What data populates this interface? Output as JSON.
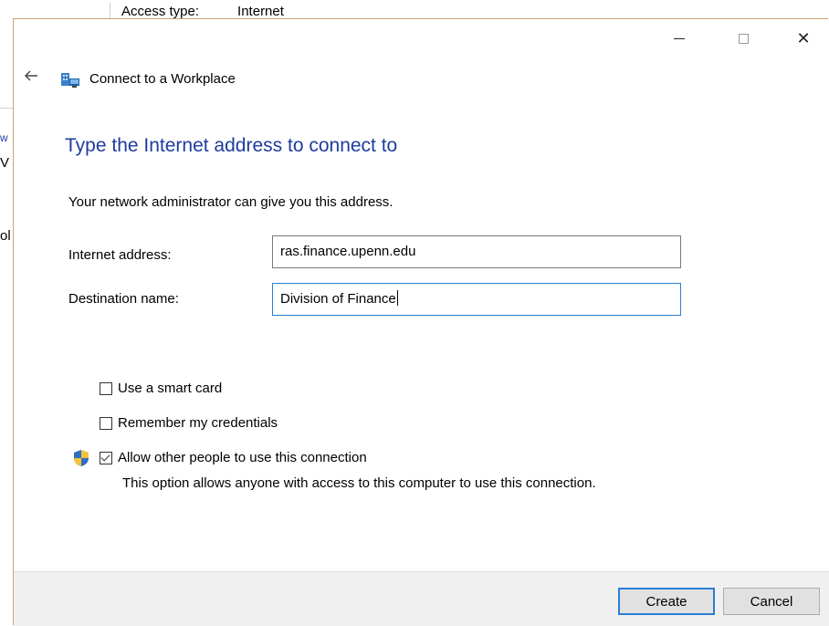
{
  "background": {
    "access_type_label": "Access type:",
    "access_type_value": "Internet",
    "left_fragments": [
      "w",
      "V",
      "ol"
    ]
  },
  "window": {
    "title": "Connect to a Workplace",
    "controls": {
      "minimize": "minimize",
      "maximize": "maximize",
      "close": "✕"
    }
  },
  "page": {
    "heading": "Type the Internet address to connect to",
    "instruction": "Your network administrator can give you this address.",
    "internet_address_label": "Internet address:",
    "internet_address_value": "ras.finance.upenn.edu",
    "destination_name_label": "Destination name:",
    "destination_name_value": "Division of Finance"
  },
  "options": {
    "smart_card_label": "Use a smart card",
    "smart_card_checked": false,
    "remember_label": "Remember my credentials",
    "remember_checked": false,
    "allow_others_label": "Allow other people to use this connection",
    "allow_others_checked": true,
    "allow_others_description": "This option allows anyone with access to this computer to use this connection."
  },
  "buttons": {
    "create": "Create",
    "cancel": "Cancel"
  },
  "colors": {
    "heading": "#1e3c9e",
    "focus_border": "#2a7fd4",
    "footer_bg": "#f0f0f0",
    "window_border": "#c9a472"
  },
  "icons": [
    "back-arrow-icon",
    "workplace-icon",
    "uac-shield-icon"
  ]
}
